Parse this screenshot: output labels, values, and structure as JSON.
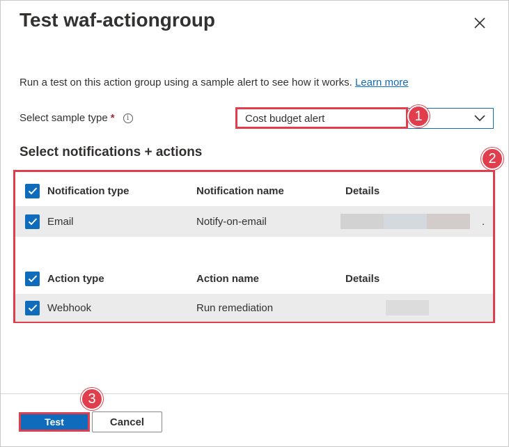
{
  "dialog": {
    "title": "Test waf-actiongroup",
    "description": "Run a test on this action group using a sample alert to see how it works.",
    "learn_more": "Learn more"
  },
  "sample": {
    "label": "Select sample type",
    "required_mark": "*",
    "selected_value": "Cost budget alert"
  },
  "section_title": "Select notifications + actions",
  "notifications": {
    "headers": [
      "Notification type",
      "Notification name",
      "Details"
    ],
    "rows": [
      {
        "type": "Email",
        "name": "Notify-on-email",
        "details": "."
      }
    ]
  },
  "actions": {
    "headers": [
      "Action type",
      "Action name",
      "Details"
    ],
    "rows": [
      {
        "type": "Webhook",
        "name": "Run remediation"
      }
    ]
  },
  "buttons": {
    "test": "Test",
    "cancel": "Cancel"
  },
  "callouts": [
    "1",
    "2",
    "3"
  ],
  "colors": {
    "accent": "#0f6cbd",
    "highlight": "#e03e4d"
  }
}
